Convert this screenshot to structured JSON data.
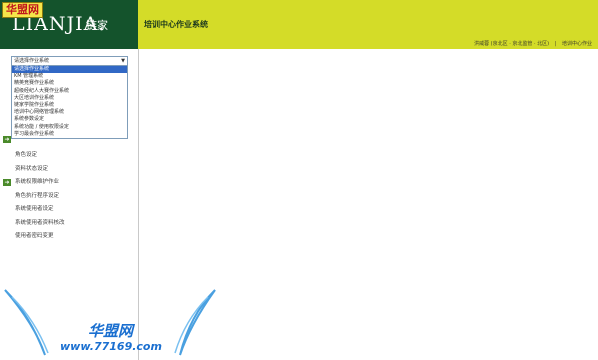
{
  "watermark": {
    "top_label": "华盟网",
    "bottom_title": "华盟网",
    "bottom_url": "www.77169.com"
  },
  "brand": {
    "logo_latin": "LIANJIA.",
    "logo_cn": "链家"
  },
  "header": {
    "system_title": "培训中心作业系统",
    "user_info": "洪威蓉 (京北区 · 京北监管 · 北区)",
    "separator": "|",
    "current_system": "培训中心作业"
  },
  "sidebar": {
    "selector": {
      "value": "请选择作业系统",
      "options": [
        "请选择作业系统",
        "KM 管理系统",
        "精英竞赛作业系统",
        "超级经纪人大赛作业系统",
        "大区培训作业系统",
        "链家学院作业系统",
        "培训中心网络管理系统",
        "系统参数设定",
        "系统功能 / 使用权限设定",
        "学习最会作业系统"
      ]
    },
    "menu": [
      {
        "label": "角色设定",
        "arrow": false
      },
      {
        "label": "资料状态设定",
        "arrow": false
      },
      {
        "label": "系统权限维护作业",
        "arrow": true
      },
      {
        "label": "角色执行程序设定",
        "arrow": false
      },
      {
        "label": "系统使用者设定",
        "arrow": false
      },
      {
        "label": "系统使用者资料核改",
        "arrow": false
      },
      {
        "label": "使用者密码变更",
        "arrow": false
      }
    ]
  }
}
